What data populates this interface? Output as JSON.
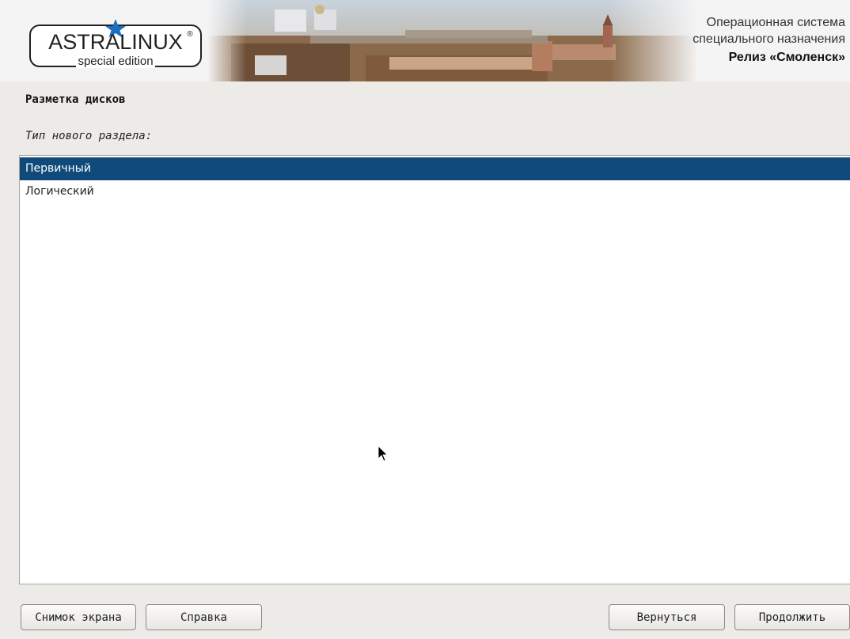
{
  "header": {
    "logo_text": "ASTRALINUX",
    "logo_registered": "®",
    "logo_subtext": "special edition",
    "os_line1": "Операционная система",
    "os_line2": "специального назначения",
    "release": "Релиз «Смоленск»",
    "accent_color": "#1a6fc0"
  },
  "page": {
    "title": "Разметка дисков",
    "question": "Тип нового раздела:"
  },
  "list": {
    "items": [
      {
        "label": "Первичный",
        "selected": true
      },
      {
        "label": "Логический",
        "selected": false
      }
    ],
    "selected_color": "#0f4a7b"
  },
  "buttons": {
    "screenshot": "Снимок экрана",
    "help": "Справка",
    "back": "Вернуться",
    "continue": "Продолжить"
  },
  "icons": {
    "logo_star": "star-icon",
    "pointer": "mouse-pointer-icon"
  }
}
